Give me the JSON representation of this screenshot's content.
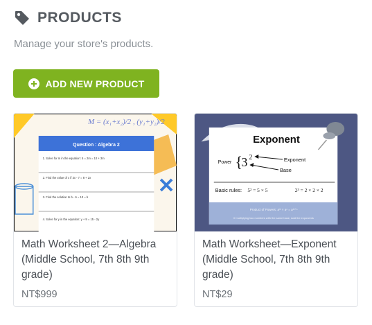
{
  "header": {
    "title": "PRODUCTS",
    "subtitle": "Manage your store's products.",
    "icon": "tag-icon"
  },
  "actions": {
    "add_label": "ADD NEW PRODUCT",
    "add_icon": "plus-circle-icon",
    "accent": "#7fb320"
  },
  "products": [
    {
      "title": "Math Worksheet 2—Algebra (Middle School, 7th 8th 9th grade)",
      "price": "NT$999",
      "thumb": {
        "header": "Question : Algebra 2",
        "formula": "M = (x₁+x₂)/2 , (y₁+y₂)/2",
        "lines": [
          "1. Solve for m in the equation: 5 = 2m = 10 + 3m",
          "2. Find the value of x if 3x - 7 = 8 + 2x",
          "3. Find the solution to b - 6 = 10 = b",
          "4. Solve for y in the equation: y + 9 = 15 - 2y"
        ]
      }
    },
    {
      "title": "Math Worksheet—Exponent (Middle School, 7th 8th 9th grade)",
      "price": "NT$29",
      "thumb": {
        "title": "Exponent",
        "power_label": "Power",
        "base": "3",
        "exp": "2",
        "exponent_label": "Exponent",
        "base_label": "Base",
        "rules_label": "Basic rules:",
        "rule1": "5² = 5 × 5",
        "rule2": "2³ = 2 × 2 × 2",
        "product_rule": "Product of Powers: aᵐ × aⁿ = aᵐ⁺ⁿ",
        "product_note": "If multiplying two numbers with the same base, Add the exponents"
      }
    }
  ]
}
